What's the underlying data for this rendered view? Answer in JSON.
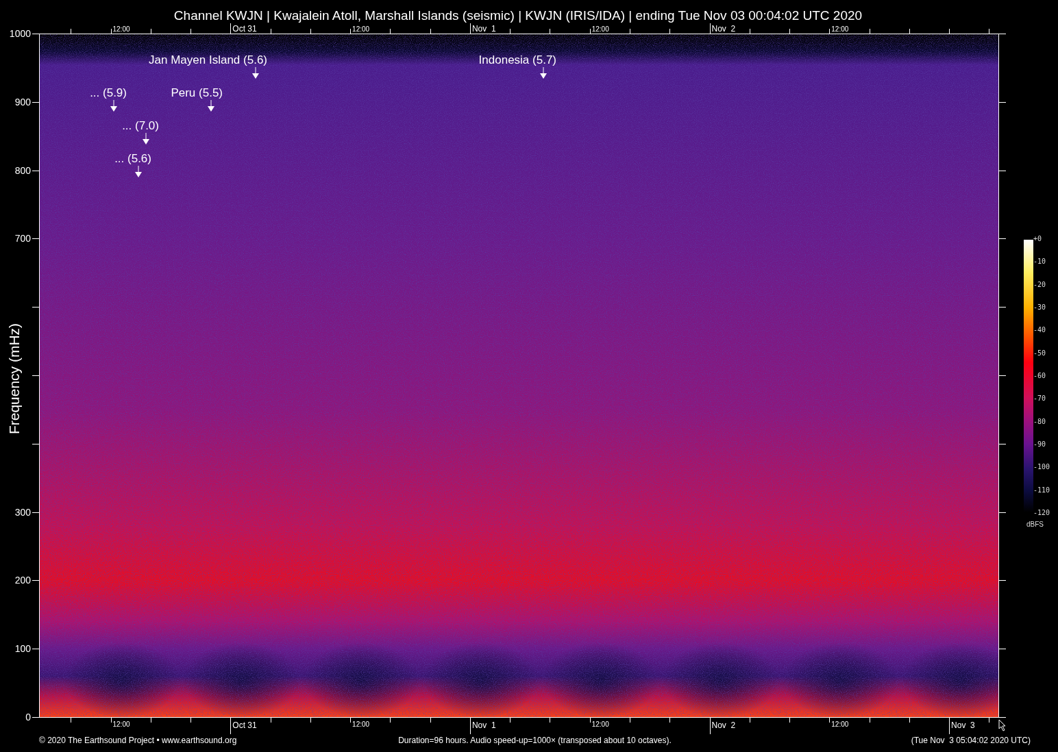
{
  "title": "Channel KWJN | Kwajalein Atoll, Marshall Islands (seismic) | KWJN (IRIS/IDA) | ending Tue Nov 03 00:04:02 UTC 2020",
  "y_axis": {
    "title": "Frequency (mHz)",
    "labels": [
      "1000",
      "900",
      "800",
      "700",
      "300",
      "200",
      "100",
      "0"
    ]
  },
  "top_axis": [
    {
      "label": "12:00",
      "kind": "time"
    },
    {
      "label": "Oct 31",
      "kind": "date"
    },
    {
      "label": "12:00",
      "kind": "time"
    },
    {
      "label": "Nov  1",
      "kind": "date"
    },
    {
      "label": "12:00",
      "kind": "time"
    },
    {
      "label": "Nov  2",
      "kind": "date"
    },
    {
      "label": "12:00",
      "kind": "time"
    }
  ],
  "bottom_axis": [
    {
      "label": "12:00",
      "kind": "time"
    },
    {
      "label": "Oct 31",
      "kind": "date"
    },
    {
      "label": "12:00",
      "kind": "time"
    },
    {
      "label": "Nov  1",
      "kind": "date"
    },
    {
      "label": "12:00",
      "kind": "time"
    },
    {
      "label": "Nov  2",
      "kind": "date"
    },
    {
      "label": "12:00",
      "kind": "time"
    },
    {
      "label": "Nov  3",
      "kind": "date"
    }
  ],
  "events": [
    {
      "label": "Jan Mayen Island (5.6)"
    },
    {
      "label": "Indonesia (5.7)"
    },
    {
      "label": "... (5.9)"
    },
    {
      "label": "Peru (5.5)"
    },
    {
      "label": "... (7.0)"
    },
    {
      "label": "... (5.6)"
    }
  ],
  "colorbar": {
    "labels": [
      "+0",
      "-10",
      "-20",
      "-30",
      "-40",
      "-50",
      "-60",
      "-70",
      "-80",
      "-90",
      "-100",
      "-110",
      "-120"
    ],
    "unit": "dBFS"
  },
  "footer": {
    "credit": "© 2020 The Earthsound Project • www.earthsound.org",
    "note": "Duration=96 hours. Audio speed-up=1000× (transposed about 10 octaves).",
    "timestamp": "(Tue Nov  3 05:04:02 2020 UTC)"
  }
}
